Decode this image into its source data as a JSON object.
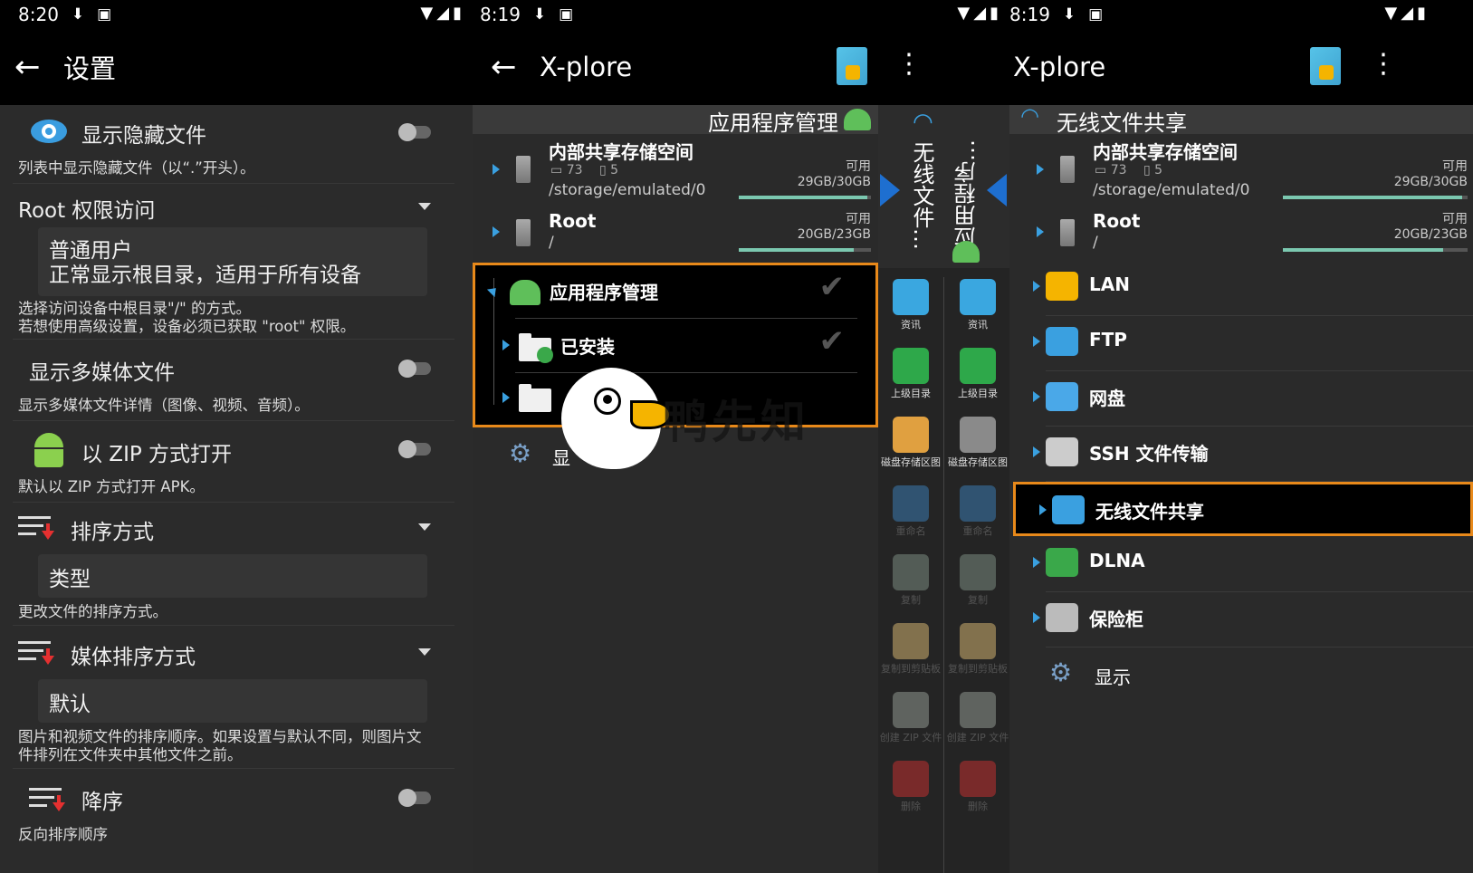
{
  "panel1": {
    "status_time": "8:20",
    "title": "设置",
    "show_hidden": {
      "title": "显示隐藏文件",
      "desc": "列表中显示隐藏文件（以“.”开头）。"
    },
    "root_access": {
      "title": "Root 权限访问",
      "value_line1": "普通用户",
      "value_line2": "正常显示根目录，适用于所有设备",
      "desc_line1": "选择访问设备中根目录\"/\" 的方式。",
      "desc_line2": "若想使用高级设置，设备必须已获取 \"root\" 权限。"
    },
    "show_media": {
      "title": "显示多媒体文件",
      "desc": "显示多媒体文件详情（图像、视频、音频）。"
    },
    "open_zip": {
      "title": "以 ZIP 方式打开",
      "desc": "默认以 ZIP 方式打开 APK。"
    },
    "sort": {
      "title": "排序方式",
      "value": "类型",
      "desc": "更改文件的排序方式。"
    },
    "media_sort": {
      "title": "媒体排序方式",
      "value": "默认",
      "desc_line1": "图片和视频文件的排序顺序。如果设置与默认不同，则图片文",
      "desc_line2": "件排列在文件夹中其他文件之前。"
    },
    "descending": {
      "title": "降序",
      "desc": "反向排序顺序"
    }
  },
  "panel2": {
    "status_time": "8:19",
    "title": "X-plore",
    "header": "应用程序管理",
    "internal": {
      "name": "内部共享存储空间",
      "folders": "73",
      "files": "5",
      "path": "/storage/emulated/0",
      "avail_label": "可用",
      "avail": "29GB/30GB",
      "fill": 0.97
    },
    "root": {
      "name": "Root",
      "path": "/",
      "avail_label": "可用",
      "avail": "20GB/23GB",
      "fill": 0.87
    },
    "app_manager": "应用程序管理",
    "installed": "已安装",
    "settings_partial": "显",
    "watermark": "鸭先知",
    "vertical_label_left": "无线文件…",
    "vertical_label_right": "应用程序…",
    "tools_left": [
      {
        "label": "资讯",
        "color": "#3aa7e0"
      },
      {
        "label": "上级目录",
        "color": "#2ea84a"
      },
      {
        "label": "磁盘存储区图",
        "color": "#e0a040"
      },
      {
        "label": "重命名",
        "color": "#3a7ab0"
      },
      {
        "label": "复制",
        "color": "#7a8a80"
      },
      {
        "label": "复制到剪贴板",
        "color": "#d0b070"
      },
      {
        "label": "创建 ZIP 文件",
        "color": "#909890"
      },
      {
        "label": "删除",
        "color": "#c03030"
      }
    ],
    "tools_right": [
      {
        "label": "资讯",
        "color": "#3aa7e0"
      },
      {
        "label": "上级目录",
        "color": "#2ea84a"
      },
      {
        "label": "磁盘存储区图",
        "color": "#8a8a8a"
      },
      {
        "label": "重命名",
        "color": "#3a7ab0"
      },
      {
        "label": "复制",
        "color": "#7a8a80"
      },
      {
        "label": "复制到剪贴板",
        "color": "#d0b070"
      },
      {
        "label": "创建 ZIP 文件",
        "color": "#909890"
      },
      {
        "label": "删除",
        "color": "#c03030"
      }
    ]
  },
  "panel3": {
    "status_time": "8:19",
    "title": "X-plore",
    "header": "无线文件共享",
    "internal": {
      "name": "内部共享存储空间",
      "folders": "73",
      "files": "5",
      "path": "/storage/emulated/0",
      "avail_label": "可用",
      "avail": "29GB/30GB",
      "fill": 0.97
    },
    "root": {
      "name": "Root",
      "path": "/",
      "avail_label": "可用",
      "avail": "20GB/23GB",
      "fill": 0.87
    },
    "items": [
      "LAN",
      "FTP",
      "网盘",
      "SSH 文件传输",
      "无线文件共享",
      "DLNA",
      "保险柜"
    ],
    "display": "显示"
  },
  "colors": {
    "highlight_border": "#e8891a",
    "accent_blue": "#3aa0e0",
    "android_green": "#5fbf5a"
  }
}
